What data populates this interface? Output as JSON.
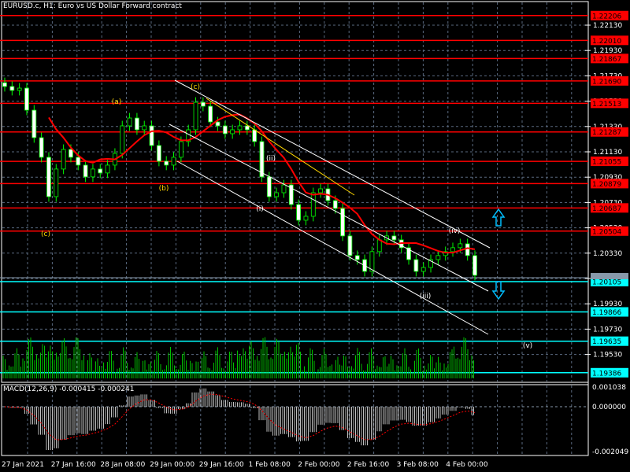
{
  "header": {
    "title": "EURUSD.c, H1:  Euro vs US Dollar Forward contract"
  },
  "macd": {
    "title": "MACD(12,26,9) -0.000415 -0.000241",
    "scale_top": "0.001038",
    "scale_zero": "0.000000",
    "scale_bottom": "-0.002049"
  },
  "colors": {
    "background": "#000000",
    "red_level": "#ff0000",
    "cyan_level": "#00ffff",
    "wave_yellow": "#ffd700",
    "wave_white": "#ffffff",
    "volume": "#00c000",
    "ma": "#ff0000",
    "channel": "#ffffff"
  },
  "chart_data": {
    "type": "candlestick",
    "symbol": "EURUSD.c",
    "timeframe": "H1",
    "ylim": [
      1.193,
      1.2233
    ],
    "price_ticks": [
      "1.22130",
      "1.21930",
      "1.21730",
      "1.21530",
      "1.21330",
      "1.21130",
      "1.20930",
      "1.20730",
      "1.20530",
      "1.20330",
      "1.20130",
      "1.19930",
      "1.19730",
      "1.19530"
    ],
    "resistance_levels": [
      "1.22206",
      "1.22010",
      "1.21867",
      "1.21690",
      "1.21513",
      "1.21287",
      "1.21055",
      "1.20879",
      "1.20687",
      "1.20504"
    ],
    "support_levels": [
      "1.20105",
      "1.19866",
      "1.19635",
      "1.19386"
    ],
    "current_price": "1.20136",
    "time_labels": [
      "27 Jan 2021",
      "27 Jan 16:00",
      "28 Jan 08:00",
      "29 Jan 00:00",
      "29 Jan 16:00",
      "1 Feb 08:00",
      "2 Feb 00:00",
      "2 Feb 16:00",
      "3 Feb 08:00",
      "4 Feb 00:00"
    ],
    "closes": [
      1.21646,
      1.21615,
      1.21633,
      1.21459,
      1.21242,
      1.21087,
      1.20776,
      1.20994,
      1.21149,
      1.21087,
      1.21025,
      1.20932,
      1.20994,
      1.20963,
      1.21025,
      1.21118,
      1.21335,
      1.21397,
      1.21304,
      1.21335,
      1.2118,
      1.21056,
      1.21025,
      1.21087,
      1.21211,
      1.21304,
      1.21521,
      1.2149,
      1.21366,
      1.21335,
      1.21273,
      1.21304,
      1.21335,
      1.21304,
      1.21211,
      1.20932,
      1.20776,
      1.20807,
      1.20869,
      1.20714,
      1.2059,
      1.20621,
      1.20807,
      1.20838,
      1.20745,
      1.20683,
      1.20466,
      1.20311,
      1.20279,
      1.20186,
      1.20342,
      1.20435,
      1.20466,
      1.20435,
      1.20373,
      1.20279,
      1.20186,
      1.20217,
      1.20279,
      1.20311,
      1.20342,
      1.20373,
      1.20404,
      1.20311,
      1.20155
    ],
    "wave_labels": [
      {
        "text": "(c)",
        "color": "yellow"
      },
      {
        "text": "(a)",
        "color": "yellow"
      },
      {
        "text": "(b)",
        "color": "yellow"
      },
      {
        "text": "(c)",
        "color": "yellow"
      },
      {
        "text": "(ii)",
        "color": "white"
      },
      {
        "text": "(i)",
        "color": "white"
      },
      {
        "text": "(iii)",
        "color": "white"
      },
      {
        "text": "(iv)",
        "color": "white"
      },
      {
        "text": "(v)",
        "color": "white"
      }
    ],
    "arrows": [
      "up-arrow",
      "down-arrow"
    ]
  }
}
